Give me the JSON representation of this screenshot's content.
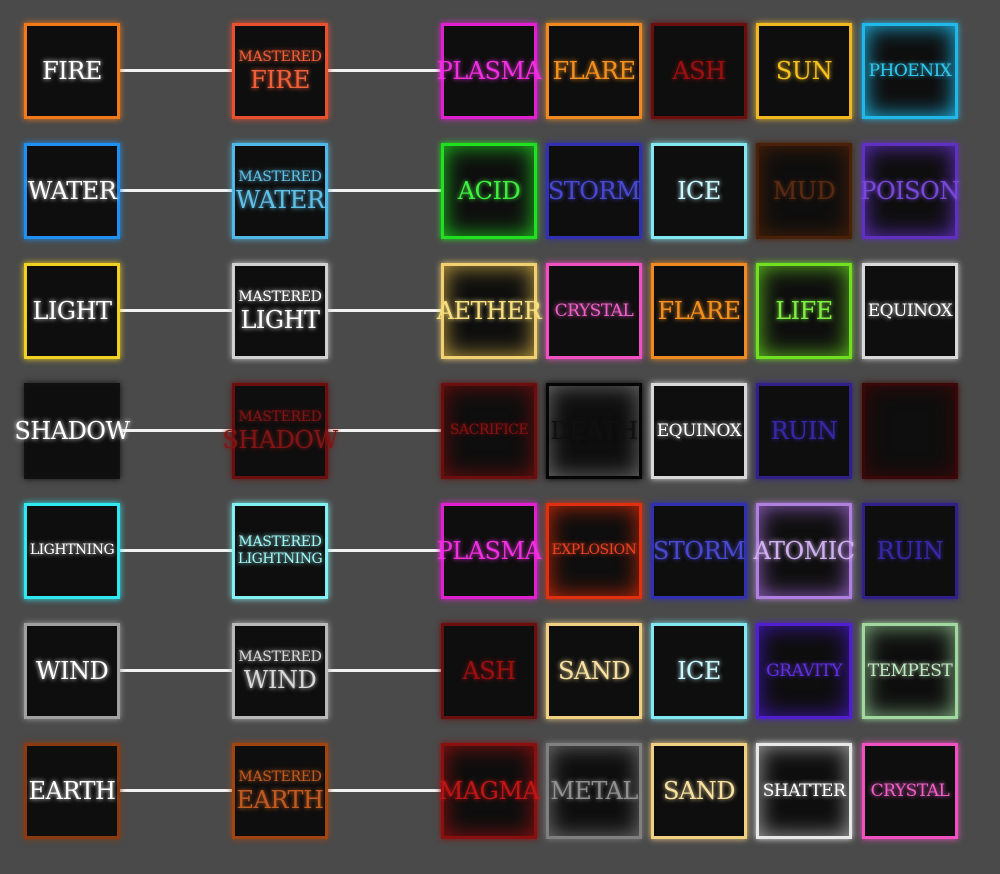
{
  "rows": [
    {
      "base": {
        "label": "FIRE",
        "border": "#f07a1a",
        "text": "#ffffff"
      },
      "mastered": {
        "prefix": "MASTERED",
        "label": "FIRE",
        "border": "#e8502e",
        "text": "#f0603a"
      },
      "combos": [
        {
          "label": "PLASMA",
          "border": "#e020d0",
          "text": "#f030e0"
        },
        {
          "label": "FLARE",
          "border": "#f08a20",
          "text": "#f5901e"
        },
        {
          "label": "ASH",
          "border": "#6a0e0e",
          "text": "#9a1010"
        },
        {
          "label": "SUN",
          "border": "#f0b820",
          "text": "#f5c020"
        },
        {
          "label": "PHOENIX",
          "border": "#20b8e8",
          "text": "#30c8f0",
          "glow": "#20b8e8"
        }
      ]
    },
    {
      "base": {
        "label": "WATER",
        "border": "#2090f0",
        "text": "#ffffff"
      },
      "mastered": {
        "prefix": "MASTERED",
        "label": "WATER",
        "border": "#50b8e8",
        "text": "#60c0e8"
      },
      "combos": [
        {
          "label": "ACID",
          "border": "#20e020",
          "text": "#40f040",
          "glow": "#20c020"
        },
        {
          "label": "STORM",
          "border": "#3030b0",
          "text": "#4848d0"
        },
        {
          "label": "ICE",
          "border": "#80e8f0",
          "text": "#c8f8ff"
        },
        {
          "label": "MUD",
          "border": "#4a2008",
          "text": "#5a2a10",
          "glow": "#4a2008"
        },
        {
          "label": "POISON",
          "border": "#6030c0",
          "text": "#7848d8",
          "glow": "#6030c0"
        }
      ]
    },
    {
      "base": {
        "label": "LIGHT",
        "border": "#f0d020",
        "text": "#ffffff"
      },
      "mastered": {
        "prefix": "MASTERED",
        "label": "LIGHT",
        "border": "#d0d0d0",
        "text": "#ffffff"
      },
      "combos": [
        {
          "label": "AETHER",
          "border": "#f0d070",
          "text": "#f8e080",
          "glow": "#c0a040"
        },
        {
          "label": "CRYSTAL",
          "border": "#f050c0",
          "text": "#f060c8"
        },
        {
          "label": "FLARE",
          "border": "#f08a20",
          "text": "#f5901e"
        },
        {
          "label": "LIFE",
          "border": "#70e020",
          "text": "#80f040",
          "glow": "#60c020"
        },
        {
          "label": "EQUINOX",
          "border": "#d8d8d8",
          "text": "#ffffff"
        }
      ]
    },
    {
      "base": {
        "label": "SHADOW",
        "border": "#101010",
        "text": "#ffffff"
      },
      "mastered": {
        "prefix": "MASTERED",
        "label": "SHADOW",
        "border": "#6a0e0e",
        "text": "#801515"
      },
      "combos": [
        {
          "label": "SACRIFICE",
          "border": "#6a0e0e",
          "text": "#8a1010",
          "glow": "#6a0e0e"
        },
        {
          "label": "DEATH",
          "border": "#050505",
          "text": "#101010",
          "glow": "#6a6a6a"
        },
        {
          "label": "EQUINOX",
          "border": "#d8d8d8",
          "text": "#ffffff"
        },
        {
          "label": "RUIN",
          "border": "#302088",
          "text": "#3828a8"
        },
        {
          "label": "",
          "border": "#3a0808",
          "text": "#3a0808",
          "glow": "#3a0808"
        }
      ]
    },
    {
      "base": {
        "label": "LIGHTNING",
        "border": "#30e8f0",
        "text": "#ffffff"
      },
      "mastered": {
        "prefix": "MASTERED",
        "label": "LIGHTNING",
        "border": "#80f0f0",
        "text": "#a0f8f8"
      },
      "combos": [
        {
          "label": "PLASMA",
          "border": "#e020d0",
          "text": "#f030e0"
        },
        {
          "label": "EXPLOSION",
          "border": "#e03010",
          "text": "#f04020",
          "glow": "#c02808"
        },
        {
          "label": "STORM",
          "border": "#3030b0",
          "text": "#4848d0"
        },
        {
          "label": "ATOMIC",
          "border": "#b080e0",
          "text": "#d0b0f0",
          "glow": "#9060c0"
        },
        {
          "label": "RUIN",
          "border": "#302088",
          "text": "#3828a8"
        }
      ]
    },
    {
      "base": {
        "label": "WIND",
        "border": "#a0a0a0",
        "text": "#ffffff"
      },
      "mastered": {
        "prefix": "MASTERED",
        "label": "WIND",
        "border": "#b8b8b8",
        "text": "#d8d8d8"
      },
      "combos": [
        {
          "label": "ASH",
          "border": "#6a0e0e",
          "text": "#9a1010"
        },
        {
          "label": "SAND",
          "border": "#f0d080",
          "text": "#f8e0a0"
        },
        {
          "label": "ICE",
          "border": "#80e8f0",
          "text": "#c8f8ff"
        },
        {
          "label": "GRAVITY",
          "border": "#5020d0",
          "text": "#6030e0",
          "glow": "#4018b0"
        },
        {
          "label": "TEMPEST",
          "border": "#a0d8a0",
          "text": "#c0e8c0",
          "glow": "#80b080"
        }
      ]
    },
    {
      "base": {
        "label": "EARTH",
        "border": "#8a3a10",
        "text": "#ffffff"
      },
      "mastered": {
        "prefix": "MASTERED",
        "label": "EARTH",
        "border": "#a04510",
        "text": "#c05a20"
      },
      "combos": [
        {
          "label": "MAGMA",
          "border": "#8a1010",
          "text": "#c01515",
          "glow": "#8a1010"
        },
        {
          "label": "METAL",
          "border": "#808080",
          "text": "#909090",
          "glow": "#707070"
        },
        {
          "label": "SAND",
          "border": "#f0d080",
          "text": "#f8e0a0"
        },
        {
          "label": "SHATTER",
          "border": "#e8e8e8",
          "text": "#ffffff",
          "glow": "#a0a0a0"
        },
        {
          "label": "CRYSTAL",
          "border": "#f050c0",
          "text": "#f060c8"
        }
      ]
    }
  ]
}
